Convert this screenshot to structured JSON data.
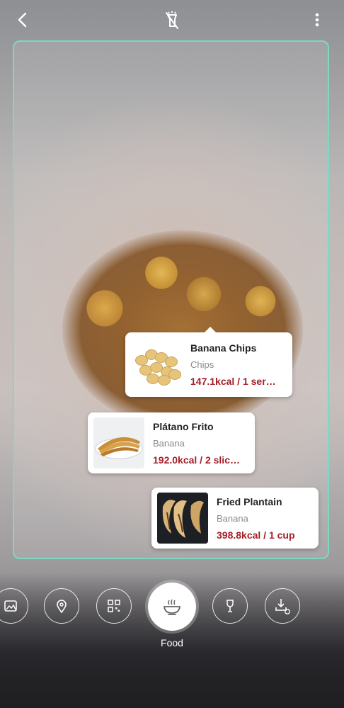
{
  "topbar": {
    "back_icon": "chevron-left-icon",
    "flash_icon": "flash-off-icon",
    "more_icon": "more-vertical-icon"
  },
  "results": [
    {
      "name": "Banana Chips",
      "category": "Chips",
      "calories": "147.1kcal / 1 ser…",
      "thumb_icon": "banana-chips-photo"
    },
    {
      "name": "Plátano Frito",
      "category": "Banana",
      "calories": "192.0kcal / 2 slic…",
      "thumb_icon": "fried-banana-photo"
    },
    {
      "name": "Fried Plantain",
      "category": "Banana",
      "calories": "398.8kcal / 1 cup",
      "thumb_icon": "fried-plantain-photo"
    }
  ],
  "modes": {
    "items": [
      "gallery-icon",
      "location-icon",
      "qr-code-icon",
      "food-bowl-icon",
      "wine-icon",
      "download-icon"
    ],
    "active_label": "Food"
  },
  "colors": {
    "frame": "#7fd8c1",
    "calories": "#a32028"
  }
}
